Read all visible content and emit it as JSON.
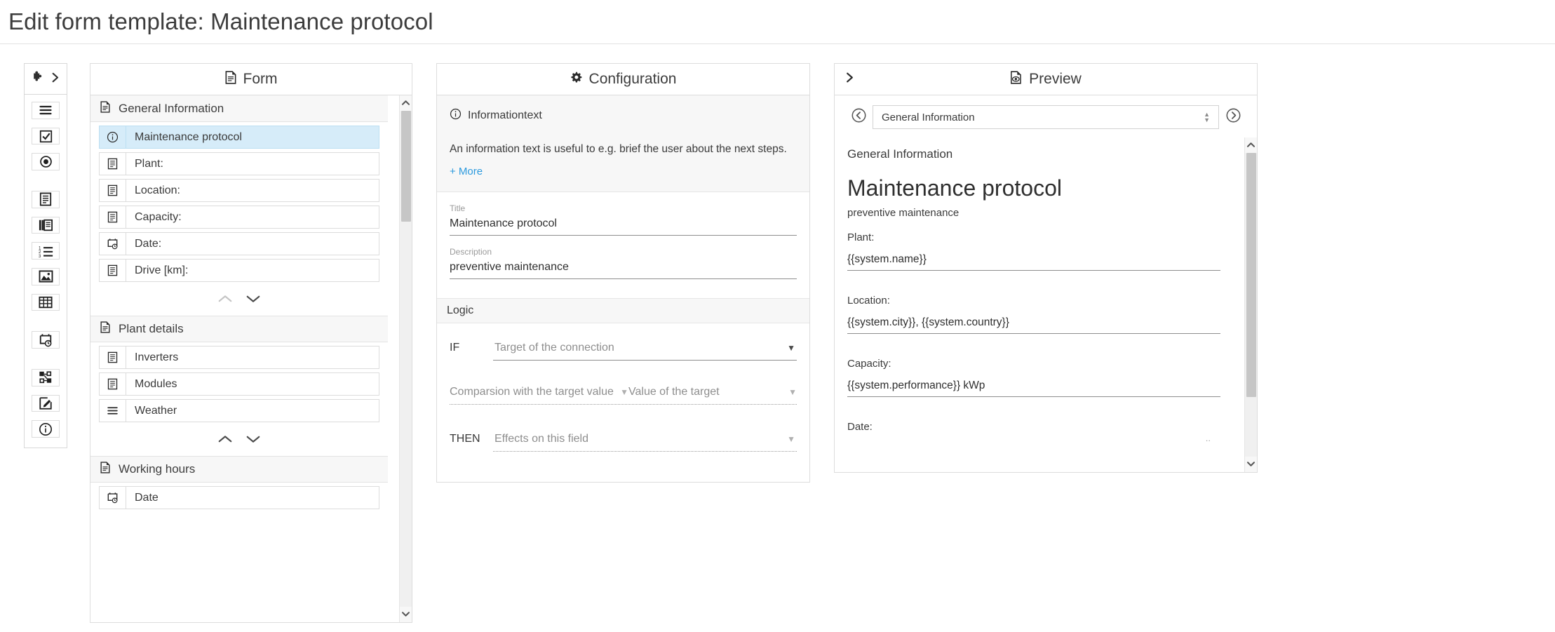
{
  "page": {
    "title": "Edit form template: Maintenance protocol"
  },
  "palette": {
    "toggle": {
      "name": "puzzle-expand",
      "icon_a": "puzzle-icon",
      "icon_b": "chevron-right-icon"
    },
    "items": [
      {
        "icon": "text-lines-icon",
        "label": "Text block"
      },
      {
        "icon": "checkbox-icon",
        "label": "Checkbox"
      },
      {
        "icon": "radio-button-icon",
        "label": "Radio button"
      },
      {
        "icon": "single-document-icon",
        "label": "Single line text"
      },
      {
        "icon": "multi-document-icon",
        "label": "Multi page"
      },
      {
        "icon": "numbered-list-icon",
        "label": "Numbered list"
      },
      {
        "icon": "image-icon",
        "label": "Image"
      },
      {
        "icon": "table-icon",
        "label": "Table"
      },
      {
        "icon": "calendar-clock-icon",
        "label": "Date time"
      },
      {
        "icon": "flow-nodes-icon",
        "label": "Logic flow"
      },
      {
        "icon": "edit-square-icon",
        "label": "Signature"
      },
      {
        "icon": "info-circle-icon",
        "label": "Information text"
      }
    ]
  },
  "form": {
    "header": {
      "title": "Form",
      "icon": "document-icon"
    },
    "groups": [
      {
        "name": "General Information",
        "fields": [
          {
            "label": "Maintenance protocol",
            "icon": "info-circle-icon",
            "selected": true
          },
          {
            "label": "Plant:",
            "icon": "single-document-icon",
            "selected": false
          },
          {
            "label": "Location:",
            "icon": "single-document-icon",
            "selected": false
          },
          {
            "label": "Capacity:",
            "icon": "single-document-icon",
            "selected": false
          },
          {
            "label": "Date:",
            "icon": "calendar-clock-icon",
            "selected": false
          },
          {
            "label": "Drive [km]:",
            "icon": "single-document-icon",
            "selected": false
          }
        ],
        "move_up_enabled": false,
        "move_down_enabled": true
      },
      {
        "name": "Plant details",
        "fields": [
          {
            "label": "Inverters",
            "icon": "single-document-icon",
            "selected": false
          },
          {
            "label": "Modules",
            "icon": "single-document-icon",
            "selected": false
          },
          {
            "label": "Weather",
            "icon": "text-lines-icon",
            "selected": false
          }
        ],
        "move_up_enabled": true,
        "move_down_enabled": true
      },
      {
        "name": "Working hours",
        "fields": [
          {
            "label": "Date",
            "icon": "calendar-clock-icon",
            "selected": false
          }
        ],
        "move_up_enabled": true,
        "move_down_enabled": true
      }
    ],
    "scrollbar": {
      "up_arrow": "chevron-up-icon",
      "down_arrow": "chevron-down-icon"
    }
  },
  "configuration": {
    "header": {
      "title": "Configuration",
      "icon": "gear-icon"
    },
    "info": {
      "type_label": "Informationtext",
      "type_icon": "info-circle-icon",
      "description": "An information text is useful to e.g. brief the user about the next steps.",
      "more_label": "+ More"
    },
    "fields": [
      {
        "label": "Title",
        "value": "Maintenance protocol"
      },
      {
        "label": "Description",
        "value": "preventive maintenance"
      }
    ],
    "logic": {
      "section_label": "Logic",
      "if_label": "IF",
      "if_placeholder": "Target of the connection",
      "comparison_placeholder": "Comparsion with the target value",
      "value_placeholder": "Value of the target",
      "then_label": "THEN",
      "then_placeholder": "Effects on this field"
    }
  },
  "preview": {
    "header": {
      "title": "Preview",
      "icon": "document-eye-icon",
      "collapse_icon": "chevron-right-icon"
    },
    "nav": {
      "prev_icon": "circle-chevron-left-icon",
      "next_icon": "circle-chevron-right-icon",
      "selected_page": "General Information"
    },
    "section_title": "General Information",
    "heading": "Maintenance protocol",
    "subheading": "preventive maintenance",
    "fields": [
      {
        "label": "Plant:",
        "value": "{{system.name}}"
      },
      {
        "label": "Location:",
        "value": "{{system.city}}, {{system.country}}"
      },
      {
        "label": "Capacity:",
        "value": "{{system.performance}} kWp"
      },
      {
        "label": "Date:",
        "value": ""
      }
    ],
    "scrollbar": {
      "up_arrow": "chevron-up-icon",
      "down_arrow": "chevron-down-icon"
    }
  },
  "colors": {
    "accent": "#2c9ade",
    "selected_row": "#d6ecf9",
    "panel_border": "#dddddd",
    "group_header_bg": "#f7f7f7"
  }
}
